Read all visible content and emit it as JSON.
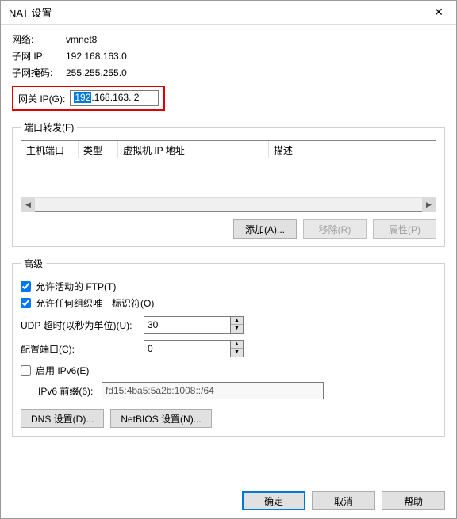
{
  "title": "NAT 设置",
  "network": {
    "label": "网络:",
    "value": "vmnet8"
  },
  "subnet_ip": {
    "label": "子网 IP:",
    "value": "192.168.163.0"
  },
  "subnet_mask": {
    "label": "子网掩码:",
    "value": "255.255.255.0"
  },
  "gateway": {
    "label": "网关 IP(G):",
    "oct1": "192",
    "rest": ".168.163. 2"
  },
  "port_forward": {
    "legend": "端口转发(F)",
    "cols": {
      "host_port": "主机端口",
      "type": "类型",
      "vm_ip": "虚拟机 IP 地址",
      "desc": "描述"
    },
    "buttons": {
      "add": "添加(A)...",
      "remove": "移除(R)",
      "props": "属性(P)"
    }
  },
  "advanced": {
    "legend": "高级",
    "allow_ftp": "允许活动的 FTP(T)",
    "allow_oid": "允许任何组织唯一标识符(O)",
    "udp_timeout": {
      "label": "UDP 超时(以秒为单位)(U):",
      "value": "30"
    },
    "config_port": {
      "label": "配置端口(C):",
      "value": "0"
    },
    "enable_ipv6": "启用 IPv6(E)",
    "ipv6_prefix": {
      "label": "IPv6 前缀(6):",
      "value": "fd15:4ba5:5a2b:1008::/64"
    },
    "dns_btn": "DNS 设置(D)...",
    "netbios_btn": "NetBIOS 设置(N)..."
  },
  "footer": {
    "ok": "确定",
    "cancel": "取消",
    "help": "帮助"
  }
}
